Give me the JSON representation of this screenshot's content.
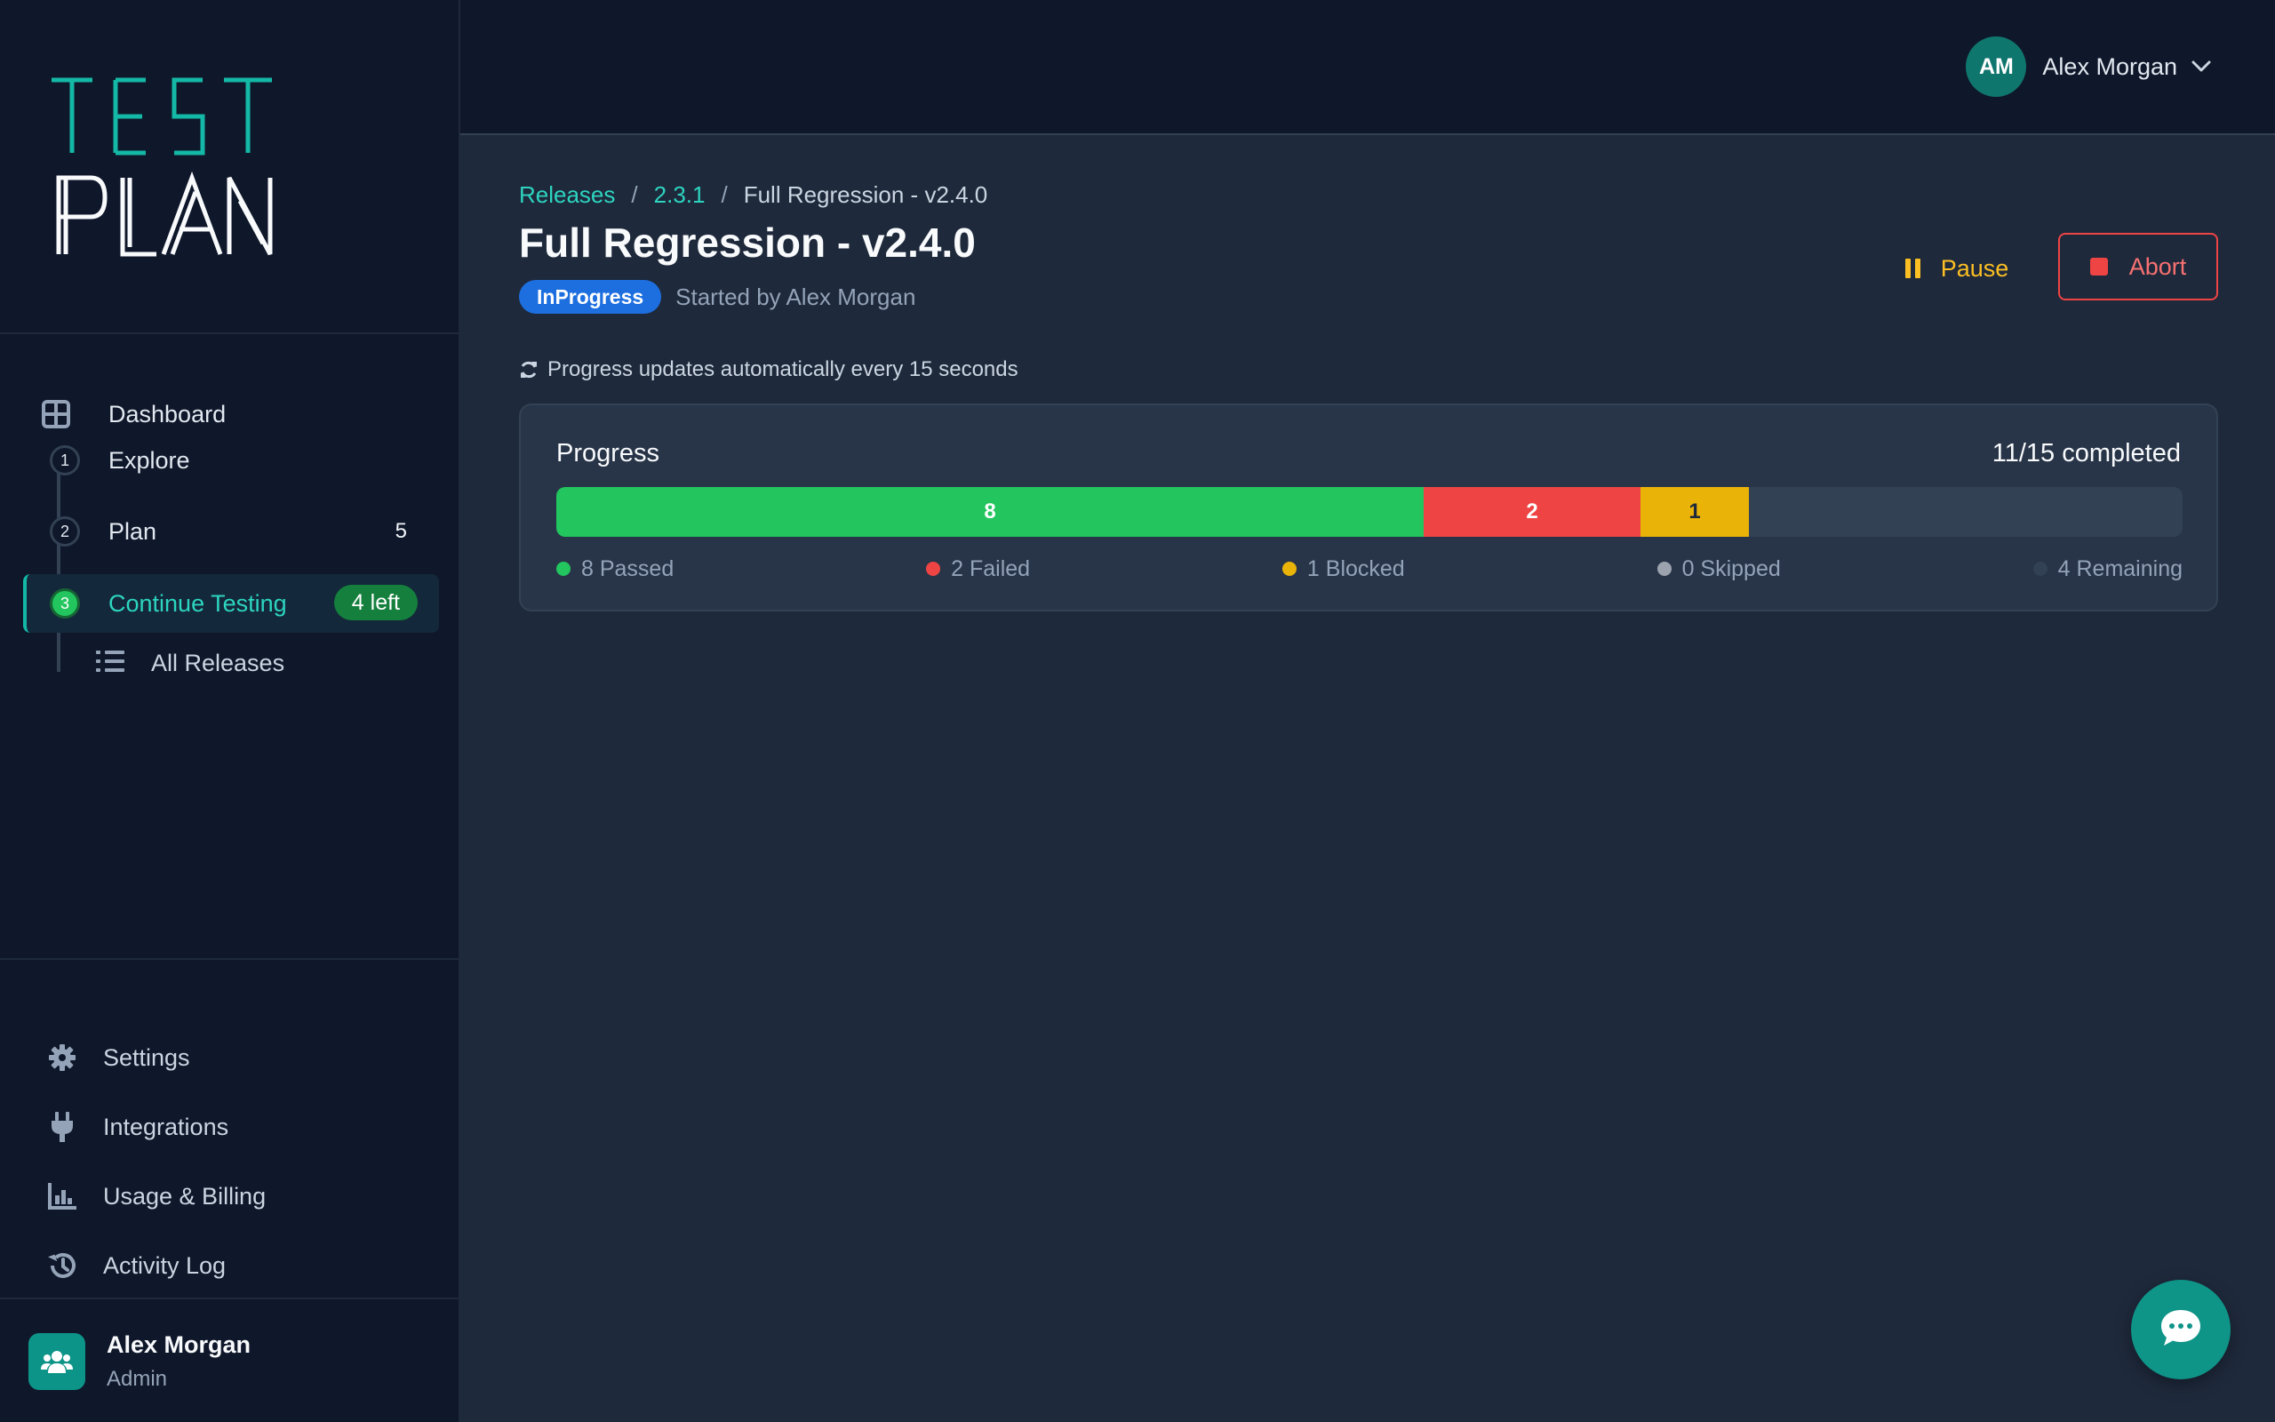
{
  "brand": {
    "line1": "TEST",
    "line2": "PLAN"
  },
  "sidebar": {
    "dashboard": {
      "label": "Dashboard",
      "icon": "grid-icon"
    },
    "steps": [
      {
        "num": "1",
        "label": "Explore",
        "count": ""
      },
      {
        "num": "2",
        "label": "Plan",
        "count": "5"
      },
      {
        "num": "3",
        "label": "Continue Testing",
        "badge": "4 left"
      }
    ],
    "all_releases": {
      "label": "All Releases",
      "icon": "list-icon"
    },
    "bottom": [
      {
        "label": "Settings",
        "icon": "gear-icon"
      },
      {
        "label": "Integrations",
        "icon": "plug-icon"
      },
      {
        "label": "Usage & Billing",
        "icon": "bar-chart-icon"
      },
      {
        "label": "Activity Log",
        "icon": "history-icon"
      }
    ],
    "user": {
      "name": "Alex Morgan",
      "role": "Admin"
    }
  },
  "topbar": {
    "initials": "AM",
    "user_name": "Alex Morgan"
  },
  "breadcrumb": {
    "releases": "Releases",
    "version": "2.3.1",
    "current": "Full Regression - v2.4.0"
  },
  "page": {
    "title": "Full Regression - v2.4.0",
    "status": "InProgress",
    "started_by": "Started by Alex Morgan",
    "pause_label": "Pause",
    "abort_label": "Abort",
    "auto_note": "Progress updates automatically every 15 seconds"
  },
  "progress": {
    "title": "Progress",
    "completed_text": "11/15 completed",
    "total": 15,
    "segments": {
      "passed": "8",
      "failed": "2",
      "blocked": "1"
    },
    "legend": {
      "passed": "8 Passed",
      "failed": "2 Failed",
      "blocked": "1 Blocked",
      "skipped": "0 Skipped",
      "remaining": "4 Remaining"
    },
    "colors": {
      "passed": "#22c55e",
      "failed": "#ef4444",
      "blocked": "#eab308",
      "skipped": "#9ca3af",
      "remaining": "#334155"
    }
  }
}
